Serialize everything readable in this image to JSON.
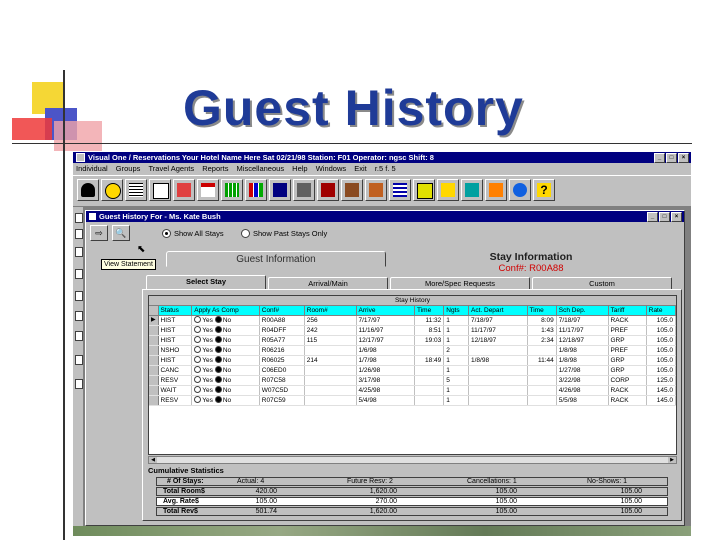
{
  "slide": {
    "title": "Guest History"
  },
  "window": {
    "title": "Visual One / Reservations  Your Hotel Name Here  Sat 02/21/98  Station: F01  Operator: ngsc  Shift: 8",
    "menu": [
      "Individual",
      "Groups",
      "Travel Agents",
      "Reports",
      "Miscellaneous",
      "Help",
      "Windows",
      "Exit",
      "r.5 f. 5"
    ]
  },
  "child": {
    "title": "Guest History For - Ms. Kate Bush",
    "radio_all": "Show All Stays",
    "radio_past": "Show Past Stays Only",
    "tooltip": "View Statement",
    "guest_info_tab": "Guest Information",
    "stay_info_title": "Stay Information",
    "conf_label": "Conf#: R00A88",
    "tabs": [
      "Select Stay",
      "Arrival/Main",
      "More/Spec Requests",
      "Custom"
    ]
  },
  "grid": {
    "caption": "Stay History",
    "columns": [
      "Status",
      "Apply As Comp",
      "Conf#",
      "Room#",
      "Arrive",
      "Time",
      "Ngts",
      "Act. Depart",
      "Time",
      "Sch Dep.",
      "Tariff",
      "Rate"
    ],
    "yes_label": "Yes",
    "no_label": "No",
    "rows": [
      [
        "HIST",
        "",
        "R00A88",
        "256",
        "7/17/97",
        "11:32",
        "1",
        "7/18/97",
        "8:09",
        "7/18/97",
        "RACK",
        "105.0"
      ],
      [
        "HIST",
        "",
        "R04DFF",
        "242",
        "11/16/97",
        "8:51",
        "1",
        "11/17/97",
        "1:43",
        "11/17/97",
        "PREF",
        "105.0"
      ],
      [
        "HIST",
        "",
        "R05A77",
        "115",
        "12/17/97",
        "19:03",
        "1",
        "12/18/97",
        "2:34",
        "12/18/97",
        "GRP",
        "105.0"
      ],
      [
        "NSHO",
        "",
        "R06216",
        "",
        "1/6/98",
        "",
        "2",
        "",
        "",
        "1/8/98",
        "PREF",
        "105.0"
      ],
      [
        "HIST",
        "",
        "R06025",
        "214",
        "1/7/98",
        "18:49",
        "1",
        "1/8/98",
        "11:44",
        "1/8/98",
        "GRP",
        "105.0"
      ],
      [
        "CANC",
        "",
        "C06ED0",
        "",
        "1/26/98",
        "",
        "1",
        "",
        "",
        "1/27/98",
        "GRP",
        "105.0"
      ],
      [
        "RESV",
        "",
        "R07C58",
        "",
        "3/17/98",
        "",
        "5",
        "",
        "",
        "3/22/98",
        "CORP",
        "125.0"
      ],
      [
        "WAIT",
        "",
        "W07C5D",
        "",
        "4/25/98",
        "",
        "1",
        "",
        "",
        "4/26/98",
        "RACK",
        "145.0"
      ],
      [
        "RESV",
        "",
        "R07C59",
        "",
        "5/4/98",
        "",
        "1",
        "",
        "",
        "5/5/98",
        "RACK",
        "145.0"
      ]
    ]
  },
  "cumulative": {
    "title": "Cumulative Statistics",
    "stays_label": "# Of Stays:",
    "actual": "Actual:  4",
    "future": "Future Resv:  2",
    "cancellations": "Cancellations:  1",
    "noshows": "No-Shows:  1",
    "rows": [
      {
        "label": "Total Room$",
        "v1": "420.00",
        "v2": "1,620.00",
        "v3": "105.00",
        "v4": "105.00"
      },
      {
        "label": "Avg. Rate$",
        "v1": "105.00",
        "v2": "270.00",
        "v3": "105.00",
        "v4": "105.00"
      },
      {
        "label": "Total Rev$",
        "v1": "501.74",
        "v2": "1,620.00",
        "v3": "105.00",
        "v4": "105.00"
      }
    ]
  },
  "colors": {
    "title_blue": "#1f3b97",
    "titlebar": "#000080",
    "grid_header": "#00ffff",
    "conf_red": "#d00000"
  }
}
